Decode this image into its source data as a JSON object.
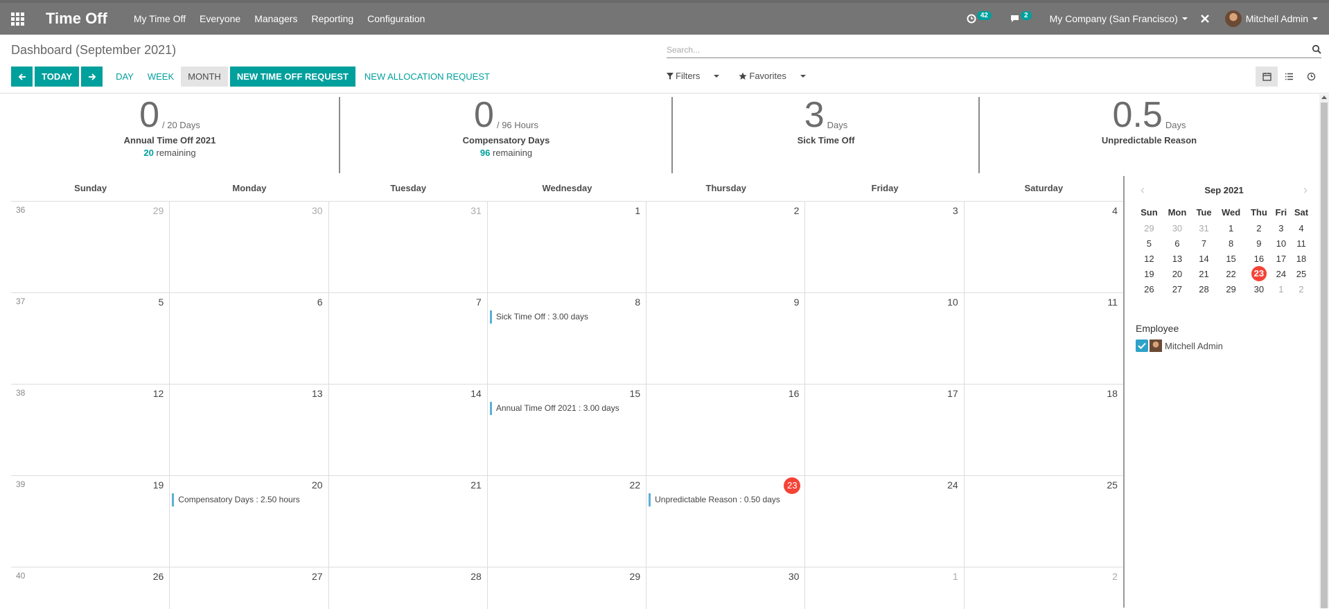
{
  "navbar": {
    "app_title": "Time Off",
    "menu": [
      "My Time Off",
      "Everyone",
      "Managers",
      "Reporting",
      "Configuration"
    ],
    "activity_count": "42",
    "message_count": "2",
    "company": "My Company (San Francisco)",
    "user": "Mitchell Admin"
  },
  "control": {
    "breadcrumb": "Dashboard (September 2021)",
    "search_placeholder": "Search...",
    "today_label": "TODAY",
    "scales": [
      "DAY",
      "WEEK",
      "MONTH"
    ],
    "active_scale": "MONTH",
    "new_timeoff_label": "NEW TIME OFF REQUEST",
    "new_allocation_label": "NEW ALLOCATION REQUEST",
    "filters_label": "Filters",
    "favorites_label": "Favorites"
  },
  "stats": [
    {
      "value": "0",
      "unit": "/ 20 Days",
      "name": "Annual Time Off 2021",
      "remaining_value": "20",
      "remaining_label": "remaining"
    },
    {
      "value": "0",
      "unit": "/ 96 Hours",
      "name": "Compensatory Days",
      "remaining_value": "96",
      "remaining_label": "remaining"
    },
    {
      "value": "3",
      "unit": "Days",
      "name": "Sick Time Off",
      "remaining_value": "",
      "remaining_label": ""
    },
    {
      "value": "0.5",
      "unit": "Days",
      "name": "Unpredictable Reason",
      "remaining_value": "",
      "remaining_label": ""
    }
  ],
  "calendar": {
    "weekdays": [
      "Sunday",
      "Monday",
      "Tuesday",
      "Wednesday",
      "Thursday",
      "Friday",
      "Saturday"
    ],
    "weeks": [
      {
        "num": "36",
        "days": [
          {
            "d": "29",
            "o": true
          },
          {
            "d": "30",
            "o": true
          },
          {
            "d": "31",
            "o": true
          },
          {
            "d": "1"
          },
          {
            "d": "2"
          },
          {
            "d": "3"
          },
          {
            "d": "4"
          }
        ]
      },
      {
        "num": "37",
        "days": [
          {
            "d": "5"
          },
          {
            "d": "6"
          },
          {
            "d": "7"
          },
          {
            "d": "8",
            "event": "Sick Time Off : 3.00 days"
          },
          {
            "d": "9"
          },
          {
            "d": "10"
          },
          {
            "d": "11"
          }
        ]
      },
      {
        "num": "38",
        "days": [
          {
            "d": "12"
          },
          {
            "d": "13"
          },
          {
            "d": "14"
          },
          {
            "d": "15",
            "event": "Annual Time Off 2021 : 3.00 days"
          },
          {
            "d": "16"
          },
          {
            "d": "17"
          },
          {
            "d": "18"
          }
        ]
      },
      {
        "num": "39",
        "days": [
          {
            "d": "19"
          },
          {
            "d": "20",
            "event": "Compensatory Days : 2.50 hours"
          },
          {
            "d": "21"
          },
          {
            "d": "22"
          },
          {
            "d": "23",
            "today": true,
            "event": "Unpredictable Reason : 0.50 days"
          },
          {
            "d": "24"
          },
          {
            "d": "25"
          }
        ]
      },
      {
        "num": "40",
        "days": [
          {
            "d": "26"
          },
          {
            "d": "27"
          },
          {
            "d": "28"
          },
          {
            "d": "29"
          },
          {
            "d": "30"
          },
          {
            "d": "1",
            "o": true
          },
          {
            "d": "2",
            "o": true
          }
        ]
      }
    ]
  },
  "mini_calendar": {
    "month": "Sep 2021",
    "weekdays": [
      "Sun",
      "Mon",
      "Tue",
      "Wed",
      "Thu",
      "Fri",
      "Sat"
    ],
    "rows": [
      [
        {
          "d": "29",
          "o": true
        },
        {
          "d": "30",
          "o": true
        },
        {
          "d": "31",
          "o": true
        },
        {
          "d": "1"
        },
        {
          "d": "2"
        },
        {
          "d": "3"
        },
        {
          "d": "4"
        }
      ],
      [
        {
          "d": "5"
        },
        {
          "d": "6"
        },
        {
          "d": "7"
        },
        {
          "d": "8"
        },
        {
          "d": "9"
        },
        {
          "d": "10"
        },
        {
          "d": "11"
        }
      ],
      [
        {
          "d": "12"
        },
        {
          "d": "13"
        },
        {
          "d": "14"
        },
        {
          "d": "15"
        },
        {
          "d": "16"
        },
        {
          "d": "17"
        },
        {
          "d": "18"
        }
      ],
      [
        {
          "d": "19"
        },
        {
          "d": "20"
        },
        {
          "d": "21"
        },
        {
          "d": "22"
        },
        {
          "d": "23",
          "today": true
        },
        {
          "d": "24"
        },
        {
          "d": "25"
        }
      ],
      [
        {
          "d": "26"
        },
        {
          "d": "27"
        },
        {
          "d": "28"
        },
        {
          "d": "29"
        },
        {
          "d": "30"
        },
        {
          "d": "1",
          "o": true
        },
        {
          "d": "2",
          "o": true
        }
      ]
    ]
  },
  "filter_panel": {
    "title": "Employee",
    "employee": "Mitchell Admin",
    "checked": true
  },
  "colors": {
    "primary": "#00a09d",
    "navbar": "#757575",
    "today": "#f44336",
    "event_bar": "#5bb0d5"
  }
}
